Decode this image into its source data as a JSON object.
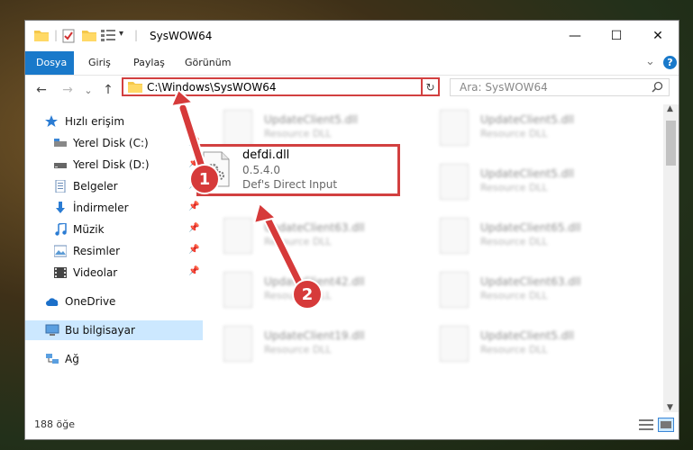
{
  "window": {
    "title": "SysWOW64",
    "controls": {
      "minimize": "—",
      "maximize": "☐",
      "close": "✕"
    }
  },
  "ribbon": {
    "tabs": [
      {
        "label": "Dosya",
        "active": true
      },
      {
        "label": "Giriş",
        "active": false
      },
      {
        "label": "Paylaş",
        "active": false
      },
      {
        "label": "Görünüm",
        "active": false
      }
    ],
    "expand_glyph": "⌄",
    "help_glyph": "?"
  },
  "navigation": {
    "back_glyph": "←",
    "forward_glyph": "→",
    "recent_glyph": "⌄",
    "up_glyph": "↑",
    "address": "C:\\Windows\\SysWOW64",
    "dropdown_glyph": "⌄",
    "refresh_glyph": "↻",
    "search_placeholder": "Ara: SysWOW64"
  },
  "sidebar": {
    "items": [
      {
        "label": "Hızlı erişim",
        "icon": "star-icon"
      },
      {
        "label": "Yerel Disk (C:)",
        "icon": "drive-icon"
      },
      {
        "label": "Yerel Disk (D:)",
        "icon": "drive-icon"
      },
      {
        "label": "Belgeler",
        "icon": "documents-icon"
      },
      {
        "label": "İndirmeler",
        "icon": "download-icon"
      },
      {
        "label": "Müzik",
        "icon": "music-icon"
      },
      {
        "label": "Resimler",
        "icon": "pictures-icon"
      },
      {
        "label": "Videolar",
        "icon": "videos-icon"
      },
      {
        "label": "OneDrive",
        "icon": "cloud-icon"
      },
      {
        "label": "Bu bilgisayar",
        "icon": "computer-icon"
      },
      {
        "label": "Ağ",
        "icon": "network-icon"
      }
    ]
  },
  "files": {
    "background": [
      {
        "name": "UpdateClient5.dll",
        "desc": "Resource DLL"
      },
      {
        "name": "UpdateClient5.dll",
        "desc": "Resource DLL"
      },
      {
        "name": "UpdateClient5.dll",
        "desc": "Resource DLL"
      },
      {
        "name": "UpdateClient63.dll",
        "desc": "Resource DLL"
      },
      {
        "name": "UpdateClient65.dll",
        "desc": "Resource DLL"
      },
      {
        "name": "UpdateClient42.dll",
        "desc": "Resource DLL"
      },
      {
        "name": "UpdateClient63.dll",
        "desc": "Resource DLL"
      },
      {
        "name": "UpdateClient19.dll",
        "desc": "Resource DLL"
      },
      {
        "name": "UpdateClient5.dll",
        "desc": "Resource DLL"
      }
    ],
    "target": {
      "name": "defdi.dll",
      "version": "0.5.4.0",
      "description": "Def's Direct Input"
    }
  },
  "status": {
    "item_count": "188 öğe"
  },
  "annotations": {
    "step1": "1",
    "step2": "2",
    "color": "#d63a3a"
  }
}
